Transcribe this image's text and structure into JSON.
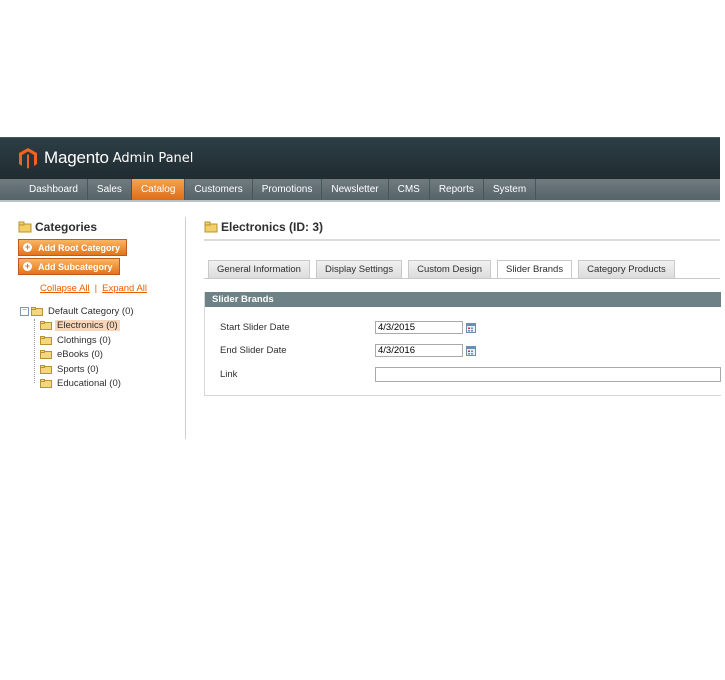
{
  "header": {
    "brand": "Magento",
    "brand_suffix": "Admin Panel",
    "logo_icon": "magento-logo-icon"
  },
  "nav": [
    {
      "label": "Dashboard",
      "active": false
    },
    {
      "label": "Sales",
      "active": false
    },
    {
      "label": "Catalog",
      "active": true
    },
    {
      "label": "Customers",
      "active": false
    },
    {
      "label": "Promotions",
      "active": false
    },
    {
      "label": "Newsletter",
      "active": false
    },
    {
      "label": "CMS",
      "active": false
    },
    {
      "label": "Reports",
      "active": false
    },
    {
      "label": "System",
      "active": false
    }
  ],
  "sidebar": {
    "title": "Categories",
    "add_root": "Add Root Category",
    "add_sub": "Add Subcategory",
    "collapse_all": "Collapse All",
    "separator": "|",
    "expand_all": "Expand All",
    "tree_root": "Default Category (0)",
    "tree_children": [
      "Electronics (0)",
      "Clothings (0)",
      "eBooks (0)",
      "Sports (0)",
      "Educational (0)"
    ],
    "selected": "Electronics (0)"
  },
  "main": {
    "title": "Electronics (ID: 3)",
    "tabs": [
      "General Information",
      "Display Settings",
      "Custom Design",
      "Slider Brands",
      "Category Products"
    ],
    "active_tab": "Slider Brands",
    "section_title": "Slider Brands",
    "fields": {
      "start_label": "Start Slider Date",
      "start_value": "4/3/2015",
      "end_label": "End Slider Date",
      "end_value": "4/3/2016",
      "link_label": "Link",
      "link_value": ""
    }
  },
  "colors": {
    "accent": "#eb5e00",
    "header_bg": "#2d3e45",
    "section_head": "#6d8187"
  }
}
